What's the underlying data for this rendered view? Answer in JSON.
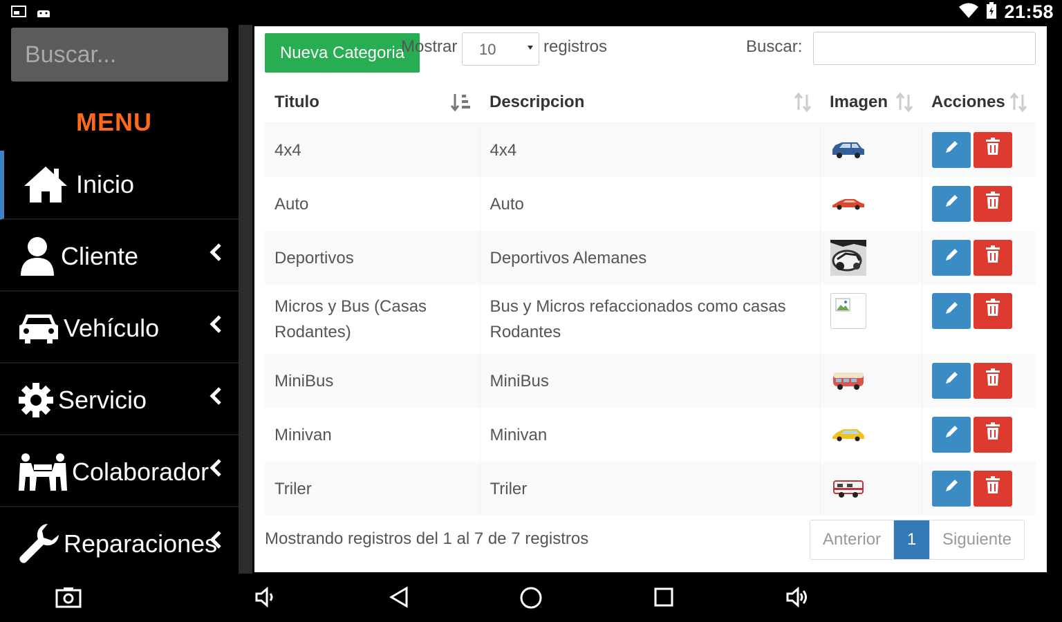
{
  "status_bar": {
    "time": "21:58"
  },
  "sidebar": {
    "search_placeholder": "Buscar...",
    "menu_title": "MENU",
    "items": [
      {
        "label": "Inicio",
        "icon": "home-icon",
        "active": true,
        "has_submenu": false
      },
      {
        "label": "Cliente",
        "icon": "user-icon",
        "active": false,
        "has_submenu": true
      },
      {
        "label": "Vehículo",
        "icon": "car-icon",
        "active": false,
        "has_submenu": true
      },
      {
        "label": "Servicio",
        "icon": "gear-icon",
        "active": false,
        "has_submenu": true
      },
      {
        "label": "Colaborador",
        "icon": "team-icon",
        "active": false,
        "has_submenu": true
      },
      {
        "label": "Reparaciones",
        "icon": "wrench-icon",
        "active": false,
        "has_submenu": true
      }
    ]
  },
  "toolbar": {
    "new_button": "Nueva Categoria",
    "show_prefix": "Mostrar",
    "page_length": "10",
    "show_suffix": "registros",
    "search_label": "Buscar:",
    "search_value": ""
  },
  "table": {
    "columns": [
      "Titulo",
      "Descripcion",
      "Imagen",
      "Acciones"
    ],
    "rows": [
      {
        "titulo": "4x4",
        "descripcion": "4x4",
        "imagen": "suv-thumbnail"
      },
      {
        "titulo": "Auto",
        "descripcion": "Auto",
        "imagen": "car-thumbnail"
      },
      {
        "titulo": "Deportivos",
        "descripcion": "Deportivos Alemanes",
        "imagen": "sports-car-thumbnail"
      },
      {
        "titulo": "Micros y Bus (Casas Rodantes)",
        "descripcion": "Bus y Micros refaccionados como casas Rodantes",
        "imagen": "broken-image"
      },
      {
        "titulo": "MiniBus",
        "descripcion": "MiniBus",
        "imagen": "minibus-thumbnail"
      },
      {
        "titulo": "Minivan",
        "descripcion": "Minivan",
        "imagen": "minivan-thumbnail"
      },
      {
        "titulo": "Triler",
        "descripcion": "Triler",
        "imagen": "trailer-thumbnail"
      }
    ]
  },
  "footer": {
    "info": "Mostrando registros del 1 al 7 de 7 registros",
    "prev": "Anterior",
    "current_page": "1",
    "next": "Siguiente"
  },
  "colors": {
    "menu_title": "#ff6a1a",
    "new_button": "#27ae52",
    "edit_button": "#3b8cc5",
    "delete_button": "#dd3b2f",
    "active_page": "#337ab7"
  }
}
